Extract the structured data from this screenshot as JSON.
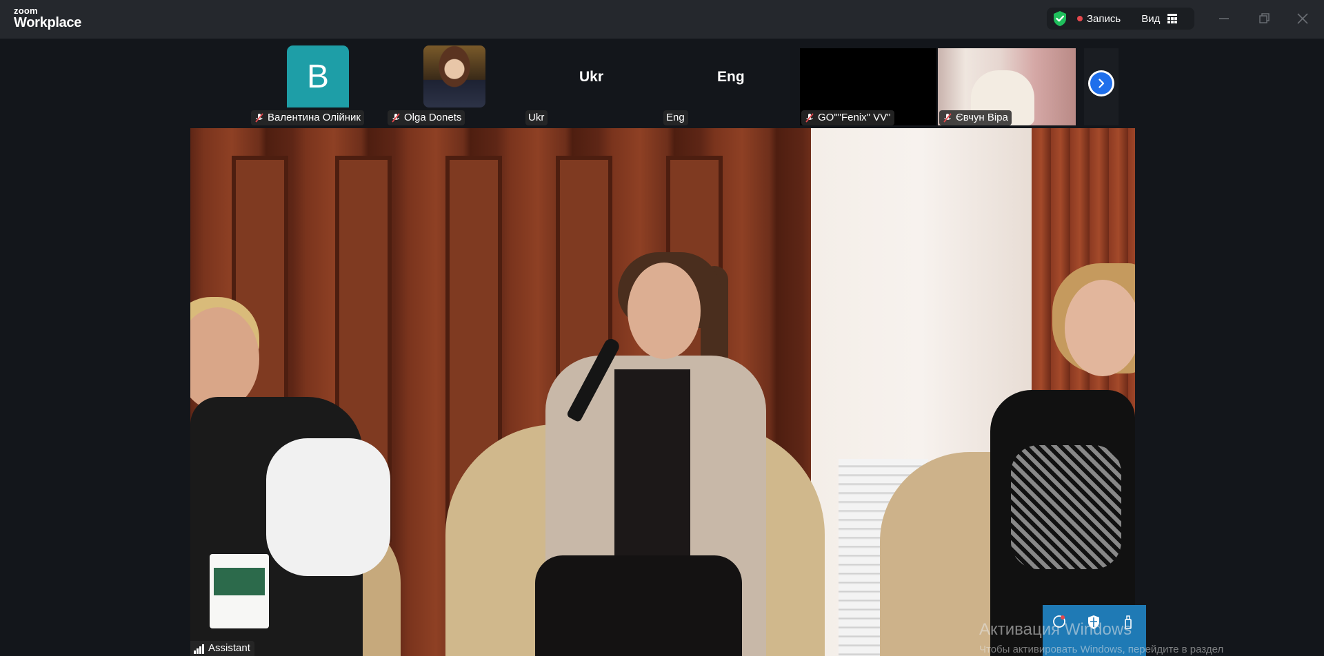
{
  "app": {
    "logo_top": "zoom",
    "logo_bottom": "Workplace"
  },
  "header": {
    "record_label": "Запись",
    "view_label": "Вид"
  },
  "participants": [
    {
      "name": "Валентина Олійник",
      "initial": "В",
      "muted": true
    },
    {
      "name": "Olga Donets",
      "muted": true
    },
    {
      "name": "Ukr",
      "tile_text": "Ukr",
      "muted": false
    },
    {
      "name": "Eng",
      "tile_text": "Eng",
      "muted": false
    },
    {
      "name": "GO\"\"Fenix\" VV\"",
      "muted": true
    },
    {
      "name": "Євчун Віра",
      "muted": true
    }
  ],
  "main_video": {
    "speaker_name": "Assistant"
  },
  "overlay": {
    "watermark_title": "Активация Windows",
    "watermark_sub": "Чтобы активировать Windows, перейдите в раздел"
  },
  "colors": {
    "accent": "#1f6feb",
    "avatar_bg": "#1e9ea7",
    "record_dot": "#e5484d",
    "shield": "#1fbf5c"
  }
}
